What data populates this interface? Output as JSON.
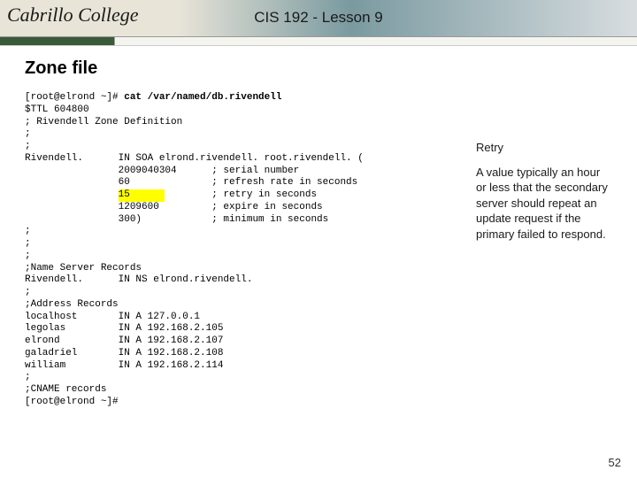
{
  "header": {
    "logo": "Cabrillo College",
    "title": "CIS 192 - Lesson 9"
  },
  "section_title": "Zone file",
  "terminal": {
    "prompt1": "[root@elrond ~]# ",
    "command": "cat /var/named/db.rivendell",
    "line_ttl": "$TTL 604800",
    "line_comment": "; Rivendell Zone Definition",
    "semi": ";",
    "soa_decl": "Rivendell.      IN SOA elrond.rivendell. root.rivendell. (",
    "soa_serial_v": "                2009040304      ",
    "soa_serial_c": "; serial number",
    "soa_refresh_v": "                60              ",
    "soa_refresh_c": "; refresh rate in seconds",
    "soa_retry_pad": "                ",
    "soa_retry_v": "15      ",
    "soa_retry_gap": "        ",
    "soa_retry_c": "; retry in seconds",
    "soa_expire_v": "                1209600         ",
    "soa_expire_c": "; expire in seconds",
    "soa_min_v": "                300)            ",
    "soa_min_c": "; minimum in seconds",
    "ns_comment": ";Name Server Records",
    "ns_record": "Rivendell.      IN NS elrond.rivendell.",
    "a_comment": ";Address Records",
    "a_localhost": "localhost       IN A 127.0.0.1",
    "a_legolas": "legolas         IN A 192.168.2.105",
    "a_elrond": "elrond          IN A 192.168.2.107",
    "a_galadriel": "galadriel       IN A 192.168.2.108",
    "a_william": "william         IN A 192.168.2.114",
    "cname_comment": ";CNAME records",
    "prompt2": "[root@elrond ~]#"
  },
  "annotation": {
    "title": "Retry",
    "body": "A value typically an hour or less that the secondary server should repeat an update request if the primary failed to respond."
  },
  "page_number": "52"
}
